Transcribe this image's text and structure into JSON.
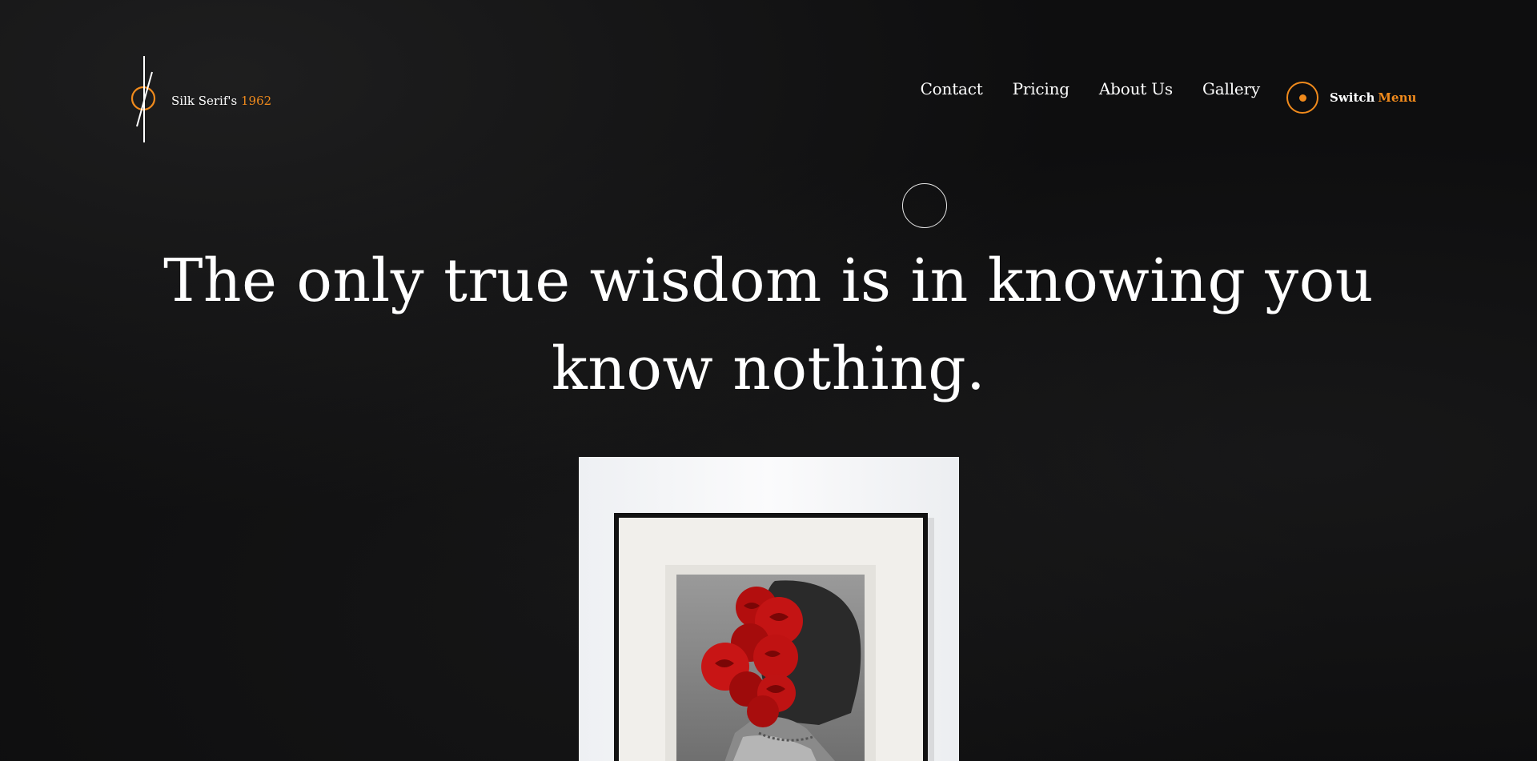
{
  "brand": {
    "name": "Silk Serif's",
    "year": "1962"
  },
  "nav": {
    "items": [
      {
        "label": "Contact"
      },
      {
        "label": "Pricing"
      },
      {
        "label": "About Us"
      },
      {
        "label": "Gallery"
      }
    ]
  },
  "switch_menu": {
    "switch_label": "Switch",
    "menu_label": "Menu"
  },
  "hero": {
    "quote": "The only true wisdom is in knowing you know nothing."
  },
  "colors": {
    "accent": "#f08a1c",
    "background": "#0e0e0f",
    "text": "#ffffff"
  },
  "icons": {
    "logo": "slashed-circle-logo-icon",
    "switch": "ring-dot-icon",
    "hero": "outline-circle-icon"
  }
}
